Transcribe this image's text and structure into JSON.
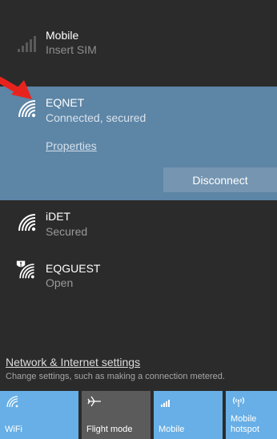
{
  "colors": {
    "panel_bg": "#2b2b2b",
    "selected_bg": "#5d85a6",
    "disconnect_bg": "#7595b1",
    "tile_on": "#67afe6",
    "tile_off": "#5b5b5b",
    "annotation_arrow": "#e8231e"
  },
  "networks": {
    "mobile": {
      "name": "Mobile",
      "status": "Insert SIM",
      "icon": "cellular-signal-icon"
    },
    "eqnet": {
      "name": "EQNET",
      "status": "Connected, secured",
      "properties_label": "Properties",
      "disconnect_label": "Disconnect",
      "icon": "wifi-icon"
    },
    "idet": {
      "name": "iDET",
      "status": "Secured",
      "icon": "wifi-icon"
    },
    "eqguest": {
      "name": "EQGUEST",
      "status": "Open",
      "icon": "wifi-warning-icon"
    }
  },
  "settings": {
    "link_label": "Network & Internet settings",
    "description": "Change settings, such as making a connection metered."
  },
  "quick_actions": [
    {
      "label": "WiFi",
      "icon": "wifi-icon",
      "active": true
    },
    {
      "label": "Flight mode",
      "icon": "airplane-icon",
      "active": false
    },
    {
      "label": "Mobile",
      "icon": "cellular-signal-icon",
      "active": true
    },
    {
      "label": "Mobile\nhotspot",
      "icon": "hotspot-icon",
      "active": true
    }
  ],
  "annotation": {
    "icon": "red-arrow-icon"
  }
}
